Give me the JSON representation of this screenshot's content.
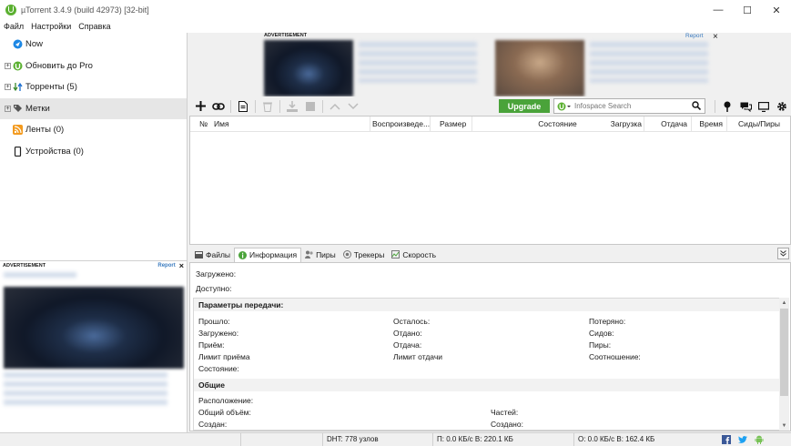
{
  "window": {
    "title": "µTorrent 3.4.9  (build 42973) [32-bit]"
  },
  "menu": {
    "items": [
      "Файл",
      "Настройки",
      "Справка"
    ]
  },
  "sidebar": {
    "items": [
      {
        "label": "Now",
        "icon": "now-icon"
      },
      {
        "label": "Обновить до Pro",
        "icon": "utorrent-icon"
      },
      {
        "label": "Торренты (5)",
        "icon": "torrents-icon"
      },
      {
        "label": "Метки",
        "icon": "tag-icon"
      },
      {
        "label": "Ленты (0)",
        "icon": "rss-icon"
      },
      {
        "label": "Устройства (0)",
        "icon": "device-icon"
      }
    ]
  },
  "side_ad": {
    "label": "ADVERTISEMENT",
    "report": "Report",
    "close": "×"
  },
  "top_ad": {
    "label": "ADVERTISEMENT",
    "report": "Report",
    "close": "×"
  },
  "toolbar": {
    "upgrade": "Upgrade",
    "search_placeholder": "Infospace Search"
  },
  "list": {
    "columns": [
      "№",
      "Имя",
      "Воспроизведе...",
      "Размер",
      "Состояние",
      "Загрузка",
      "Отдача",
      "Время",
      "Сиды/Пиры"
    ]
  },
  "tabs": [
    {
      "label": "Файлы",
      "active": false
    },
    {
      "label": "Информация",
      "active": true
    },
    {
      "label": "Пиры",
      "active": false
    },
    {
      "label": "Трекеры",
      "active": false
    },
    {
      "label": "Скорость",
      "active": false
    }
  ],
  "info": {
    "downloaded": "Загружено:",
    "available": "Доступно:",
    "transfer_header": "Параметры передачи:",
    "transfer": {
      "col1": [
        "Прошло:",
        "Загружено:",
        "Приём:",
        "Лимит приёма",
        "Состояние:"
      ],
      "col2": [
        "Осталось:",
        "Отдано:",
        "Отдача:",
        "Лимит отдачи"
      ],
      "col3": [
        "Потеряно:",
        "Сидов:",
        "Пиры:",
        "Соотношение:"
      ]
    },
    "general_header": "Общие",
    "general": {
      "col1": [
        "Расположение:",
        "Общий объём:",
        "Создан:"
      ],
      "col2": [
        "Частей:",
        "Создано:"
      ]
    }
  },
  "status": {
    "dht": "DHT: 778 узлов",
    "download": "П: 0.0 КБ/с В: 220.1 КБ",
    "upload": "О: 0.0 КБ/с В: 162.4 КБ"
  },
  "colors": {
    "accent_green": "#4aa33a",
    "link_blue": "#3b7bbf"
  }
}
